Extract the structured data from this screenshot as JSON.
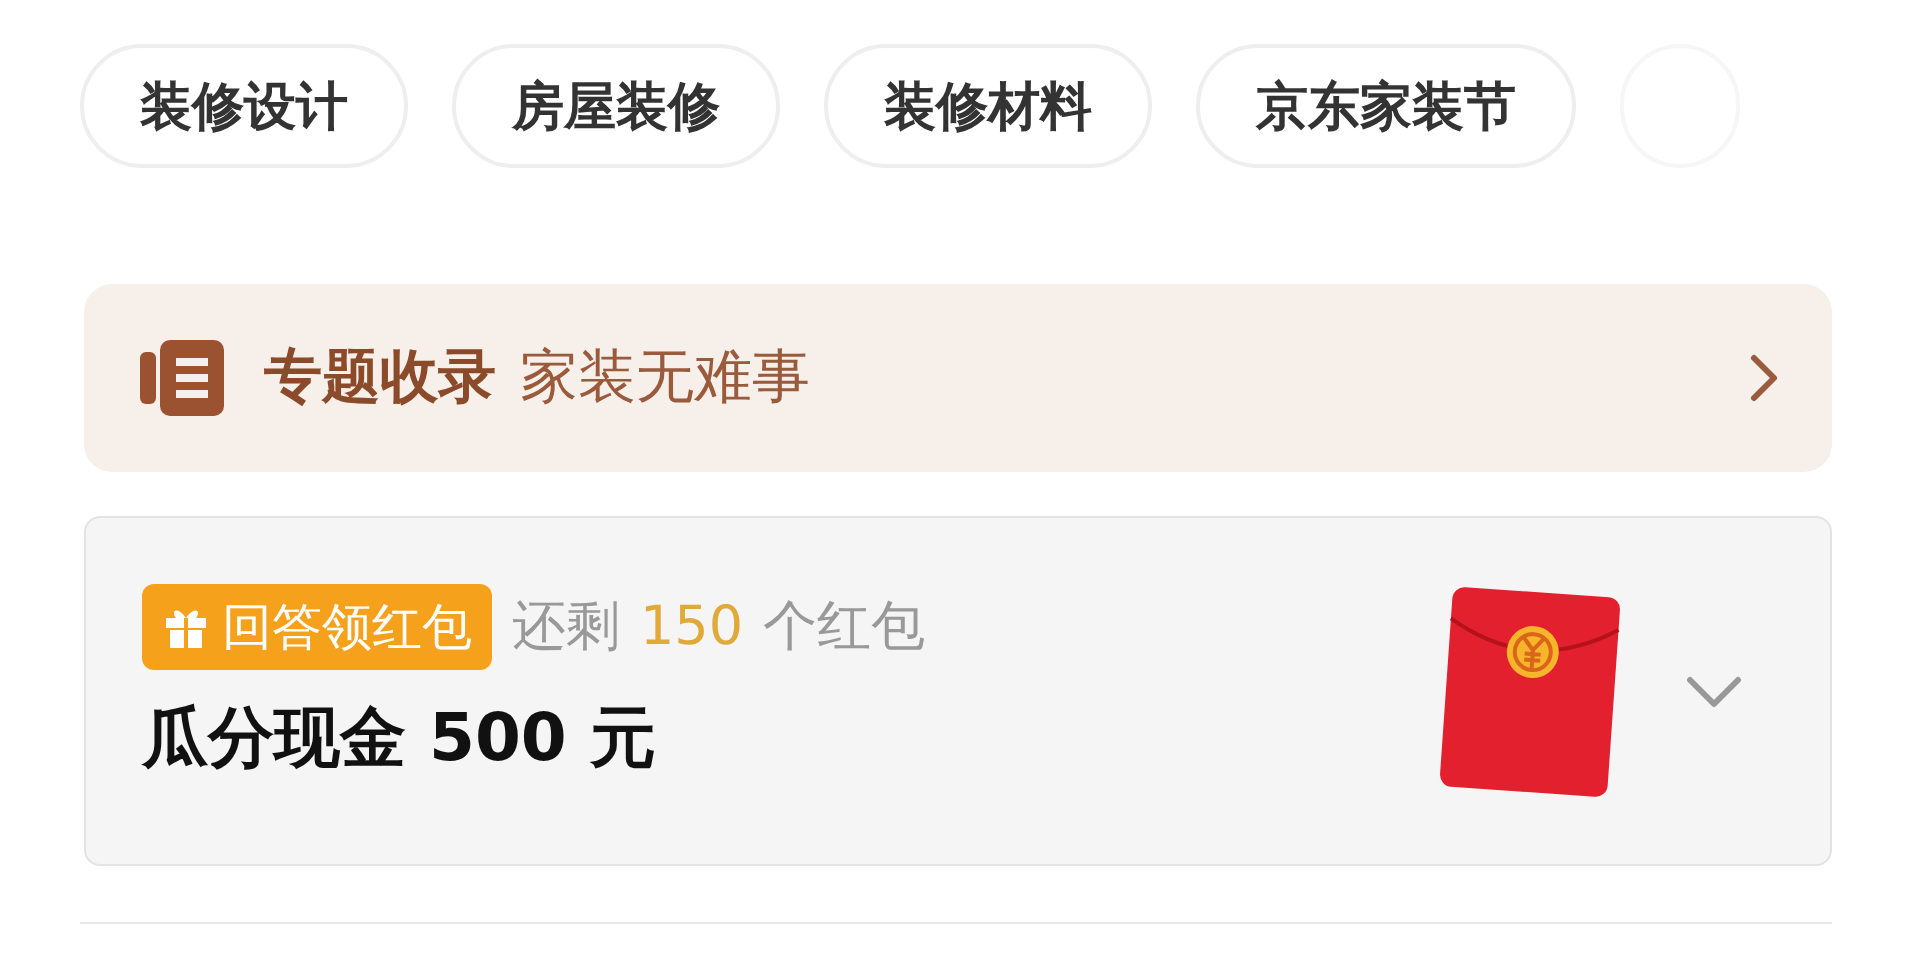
{
  "chips": [
    {
      "kind": "text",
      "label": "装修设计"
    },
    {
      "kind": "text",
      "label": "房屋装修"
    },
    {
      "kind": "text",
      "label": "装修材料"
    },
    {
      "kind": "text",
      "label": "京东家装节"
    },
    {
      "kind": "faded"
    }
  ],
  "topic": {
    "title": "专题收录",
    "subtitle": "家装无难事"
  },
  "reward": {
    "badge": "回答领红包",
    "remaining_prefix": "还剩",
    "remaining_count": "150",
    "remaining_suffix": "个红包",
    "headline": "瓜分现金 500 元",
    "expanded": false
  }
}
